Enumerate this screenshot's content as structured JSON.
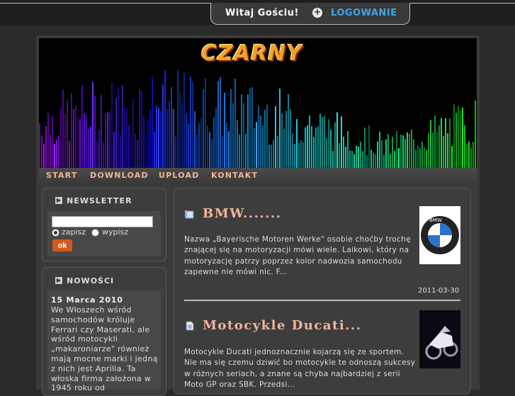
{
  "topbar": {
    "welcome": "Witaj Gościu!",
    "login_label": "LOGOWANIE"
  },
  "site": {
    "logo_text": "CZARNY"
  },
  "nav": [
    "START",
    "DOWNLOAD",
    "UPLOAD",
    "KONTAKT"
  ],
  "newsletter": {
    "title": "NEWSLETTER",
    "subscribe": "zapisz",
    "unsubscribe": "wypisz",
    "button": "ok"
  },
  "news": {
    "title": "NOWOŚCI",
    "date": "15 Marca 2010",
    "text": "We Włoszech wśród samochodów króluje Ferrari czy Maserati, ale wśród motocykli „makaroniarze\" również mają mocne marki i jedną z nich jest Aprilia. Ta włoska firma założona w 1945 roku od"
  },
  "posts": [
    {
      "title": "BMW.......",
      "body": "Nazwa „Bayerische Motoren Werke\" osobie choćby trochę znającej się na motoryzacji mówi wiele. Laikowi, który na motoryzację patrzy poprzez kolor nadwozia samochodu zapewne nie mówi nic. F...",
      "date": "2011-03-30",
      "thumb_label": "BMW"
    },
    {
      "title": "Motocykle Ducati...",
      "body": "Motocykle Ducati jednoznacznie kojarzą się ze sportem. Nie ma się czemu dziwić bo motocykle te odnoszą sukcesy w różnych seriach, a znane są chyba najbardziej z serii Moto GP oraz SBK. Przedsi..."
    }
  ],
  "colors": {
    "accent": "#f3b49a",
    "link_blue": "#3fa3e6",
    "button": "#d35a1d"
  }
}
